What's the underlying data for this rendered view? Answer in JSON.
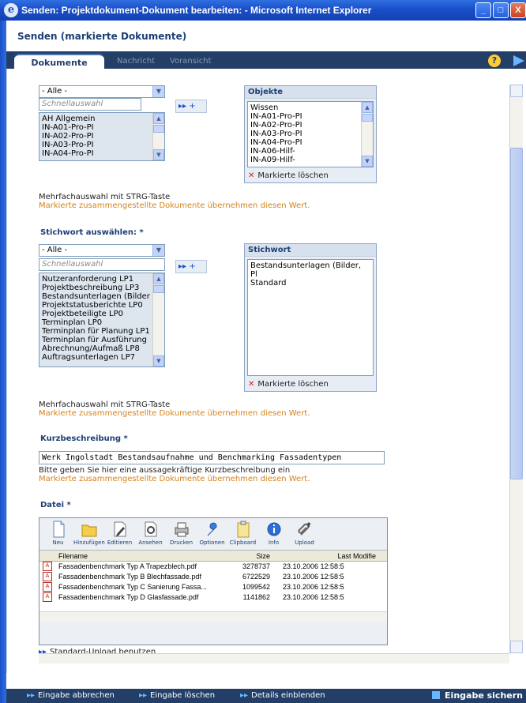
{
  "window": {
    "title": "Senden: Projektdokument-Dokument bearbeiten: - Microsoft Internet Explorer",
    "buttons": [
      "_",
      "□",
      "X"
    ]
  },
  "app": {
    "title": "Senden (markierte Dokumente)",
    "tabs": [
      "Dokumente",
      "Nachricht",
      "Voransicht"
    ],
    "help_icon": "?",
    "forward_icon": "play-icon"
  },
  "objects_section": {
    "filter_value": "- Alle -",
    "quick_placeholder": "Schnellauswahl",
    "available": [
      "AH Allgemein",
      "IN-A01-Pro-PI",
      "IN-A02-Pro-PI",
      "IN-A03-Pro-PI",
      "IN-A04-Pro-PI"
    ],
    "add_label": "▸▸ +",
    "panel_title": "Objekte",
    "selected": [
      "Wissen",
      "IN-A01-Pro-PI",
      "IN-A02-Pro-PI",
      "IN-A03-Pro-PI",
      "IN-A04-Pro-PI",
      "IN-A06-Hilf-",
      "IN-A09-Hilf-"
    ],
    "delete_label": "Markierte löschen",
    "hint": "Mehrfachauswahl mit STRG-Taste",
    "hint_orange": "Markierte zusammengestellte Dokumente übernehmen diesen Wert."
  },
  "keyword_section": {
    "heading": "Stichwort auswählen: *",
    "filter_value": "- Alle -",
    "quick_placeholder": "Schnellauswahl",
    "available": [
      "Nutzeranforderung LP1",
      "Projektbeschreibung LP3",
      "Bestandsunterlagen (Bilder",
      "Projektstatusberichte LP0",
      "Projektbeteiligte LP0",
      "Terminplan LP0",
      "Terminplan für Planung LP1",
      "Terminplan für Ausführung",
      "Abrechnung/Aufmaß LP8",
      "Auftragsunterlagen LP7"
    ],
    "add_label": "▸▸ +",
    "panel_title": "Stichwort",
    "selected": [
      "Bestandsunterlagen (Bilder, Pl",
      "Standard"
    ],
    "delete_label": "Markierte löschen",
    "hint": "Mehrfachauswahl mit STRG-Taste",
    "hint_orange": "Markierte zusammengestellte Dokumente übernehmen diesen Wert."
  },
  "description_section": {
    "heading": "Kurzbeschreibung *",
    "value": "Werk Ingolstadt Bestandsaufnahme und Benchmarking Fassadentypen",
    "hint": "Bitte geben Sie hier eine aussagekräftige Kurzbeschreibung ein",
    "hint_orange": "Markierte zusammengestellte Dokumente übernehmen diesen Wert."
  },
  "file_section": {
    "heading": "Datei *",
    "toolbar": [
      "Neu",
      "Hinzufügen",
      "Editieren",
      "Ansehen",
      "Drucken",
      "Optionen",
      "Clipboard",
      "Info",
      "Upload"
    ],
    "columns": [
      "Filename",
      "Size",
      "Last Modifie"
    ],
    "files": [
      {
        "name": "Fassadenbenchmark Typ A Trapezblech.pdf",
        "size": "3278737",
        "modified": "23.10.2006 12:58:5"
      },
      {
        "name": "Fassadenbenchmark Typ B Blechfassade.pdf",
        "size": "6722529",
        "modified": "23.10.2006 12:58:5"
      },
      {
        "name": "Fassadenbenchmark Typ C Sanierung Fassa...",
        "size": "1099542",
        "modified": "23.10.2006 12:58:5"
      },
      {
        "name": "Fassadenbenchmark Typ D Glasfassade.pdf",
        "size": "1141862",
        "modified": "23.10.2006 12:58:5"
      }
    ],
    "standard_upload": "Standard-Upload benutzen"
  },
  "bottom": {
    "cancel": "Eingabe abbrechen",
    "clear": "Eingabe löschen",
    "details": "Details einblenden",
    "save": "Eingabe sichern"
  }
}
